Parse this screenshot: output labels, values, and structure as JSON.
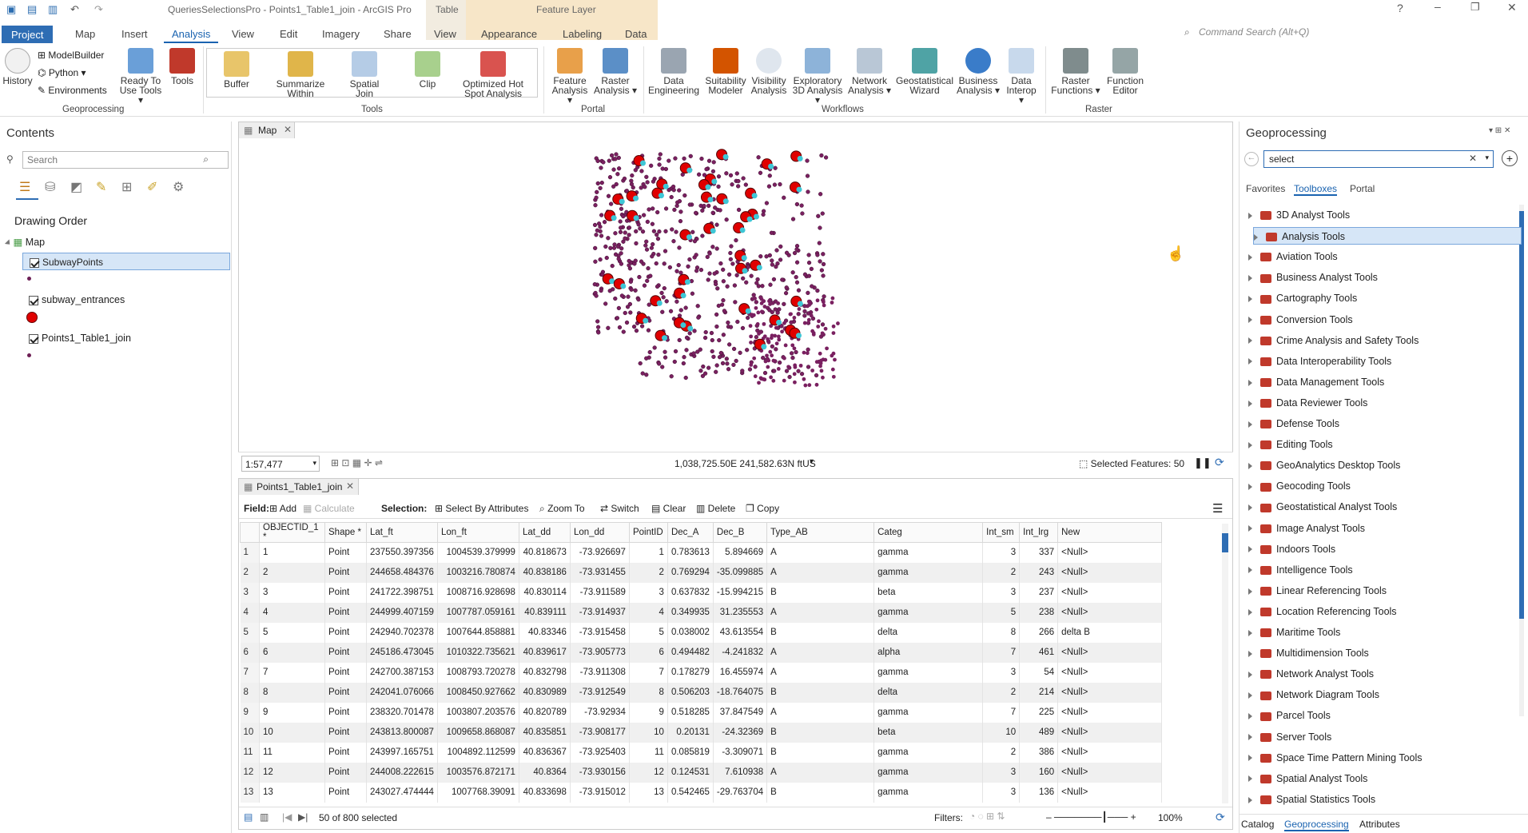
{
  "app_title": "QueriesSelectionsPro - Points1_Table1_join - ArcGIS Pro",
  "contextual": {
    "table": "Table",
    "feature_layer": "Feature Layer"
  },
  "tabs": [
    "Project",
    "Map",
    "Insert",
    "Analysis",
    "View",
    "Edit",
    "Imagery",
    "Share",
    "View",
    "Appearance",
    "Labeling",
    "Data"
  ],
  "command_search": "Command Search (Alt+Q)",
  "ribbon": {
    "history": "History",
    "modelbuilder": "ModelBuilder",
    "python": "Python",
    "environments": "Environments",
    "ready": "Ready To Use Tools",
    "tools": "Tools",
    "buffer": "Buffer",
    "summarize": "Summarize Within",
    "spatial_join": "Spatial Join",
    "clip": "Clip",
    "hotspot": "Optimized Hot Spot Analysis",
    "feature_analysis": "Feature Analysis",
    "raster_analysis": "Raster Analysis",
    "data_eng": "Data Engineering",
    "suitability": "Suitability Modeler",
    "visibility": "Visibility Analysis",
    "exploratory": "Exploratory 3D Analysis",
    "network": "Network Analysis",
    "geostat": "Geostatistical Wizard",
    "business": "Business Analysis",
    "interop": "Data Interop",
    "raster_functions": "Raster Functions",
    "function_editor": "Function Editor",
    "groups": {
      "geoprocessing": "Geoprocessing",
      "tools": "Tools",
      "portal": "Portal",
      "workflows": "Workflows",
      "raster": "Raster"
    }
  },
  "contents": {
    "title": "Contents",
    "search_placeholder": "Search",
    "drawing_order": "Drawing Order",
    "map": "Map",
    "layers": [
      "SubwayPoints",
      "subway_entrances",
      "Points1_Table1_join"
    ]
  },
  "map_tab": "Map",
  "map_footer": {
    "scale": "1:57,477",
    "coords": "1,038,725.50E 241,582.63N ftUS",
    "selected": "Selected Features: 50"
  },
  "table_tab": "Points1_Table1_join",
  "table_toolbar": {
    "field": "Field:",
    "add": "Add",
    "calculate": "Calculate",
    "selection": "Selection:",
    "select_attr": "Select By Attributes",
    "zoom": "Zoom To",
    "switch": "Switch",
    "clear": "Clear",
    "delete": "Delete",
    "copy": "Copy"
  },
  "table": {
    "columns": [
      "OBJECTID_1 *",
      "Shape *",
      "Lat_ft",
      "Lon_ft",
      "Lat_dd",
      "Lon_dd",
      "PointID",
      "Dec_A",
      "Dec_B",
      "Type_AB",
      "Categ",
      "Int_sm",
      "Int_lrg",
      "New"
    ],
    "rows": [
      [
        "1",
        "Point",
        "237550.397356",
        "1004539.379999",
        "40.818673",
        "-73.926697",
        "1",
        "0.783613",
        "5.894669",
        "A",
        "gamma",
        "3",
        "337",
        "<Null>"
      ],
      [
        "2",
        "Point",
        "244658.484376",
        "1003216.780874",
        "40.838186",
        "-73.931455",
        "2",
        "0.769294",
        "-35.099885",
        "A",
        "gamma",
        "2",
        "243",
        "<Null>"
      ],
      [
        "3",
        "Point",
        "241722.398751",
        "1008716.928698",
        "40.830114",
        "-73.911589",
        "3",
        "0.637832",
        "-15.994215",
        "B",
        "beta",
        "3",
        "237",
        "<Null>"
      ],
      [
        "4",
        "Point",
        "244999.407159",
        "1007787.059161",
        "40.839111",
        "-73.914937",
        "4",
        "0.349935",
        "31.235553",
        "A",
        "gamma",
        "5",
        "238",
        "<Null>"
      ],
      [
        "5",
        "Point",
        "242940.702378",
        "1007644.858881",
        "40.83346",
        "-73.915458",
        "5",
        "0.038002",
        "43.613554",
        "B",
        "delta",
        "8",
        "266",
        "delta B"
      ],
      [
        "6",
        "Point",
        "245186.473045",
        "1010322.735621",
        "40.839617",
        "-73.905773",
        "6",
        "0.494482",
        "-4.241832",
        "A",
        "alpha",
        "7",
        "461",
        "<Null>"
      ],
      [
        "7",
        "Point",
        "242700.387153",
        "1008793.720278",
        "40.832798",
        "-73.911308",
        "7",
        "0.178279",
        "16.455974",
        "A",
        "gamma",
        "3",
        "54",
        "<Null>"
      ],
      [
        "8",
        "Point",
        "242041.076066",
        "1008450.927662",
        "40.830989",
        "-73.912549",
        "8",
        "0.506203",
        "-18.764075",
        "B",
        "delta",
        "2",
        "214",
        "<Null>"
      ],
      [
        "9",
        "Point",
        "238320.701478",
        "1003807.203576",
        "40.820789",
        "-73.92934",
        "9",
        "0.518285",
        "37.847549",
        "A",
        "gamma",
        "7",
        "225",
        "<Null>"
      ],
      [
        "10",
        "Point",
        "243813.800087",
        "1009658.868087",
        "40.835851",
        "-73.908177",
        "10",
        "0.20131",
        "-24.32369",
        "B",
        "beta",
        "10",
        "489",
        "<Null>"
      ],
      [
        "11",
        "Point",
        "243997.165751",
        "1004892.112599",
        "40.836367",
        "-73.925403",
        "11",
        "0.085819",
        "-3.309071",
        "B",
        "gamma",
        "2",
        "386",
        "<Null>"
      ],
      [
        "12",
        "Point",
        "244008.222615",
        "1003576.872171",
        "40.8364",
        "-73.930156",
        "12",
        "0.124531",
        "7.610938",
        "A",
        "gamma",
        "3",
        "160",
        "<Null>"
      ],
      [
        "13",
        "Point",
        "243027.474444",
        "1007768.39091",
        "40.833698",
        "-73.915012",
        "13",
        "0.542465",
        "-29.763704",
        "B",
        "gamma",
        "3",
        "136",
        "<Null>"
      ]
    ]
  },
  "table_footer": {
    "selected": "50 of 800 selected",
    "filters": "Filters:",
    "zoom": "100%"
  },
  "geoprocessing": {
    "title": "Geoprocessing",
    "search_value": "select",
    "tabs": [
      "Favorites",
      "Toolboxes",
      "Portal"
    ],
    "toolboxes": [
      "3D Analyst Tools",
      "Analysis Tools",
      "Aviation Tools",
      "Business Analyst Tools",
      "Cartography Tools",
      "Conversion Tools",
      "Crime Analysis and Safety Tools",
      "Data Interoperability Tools",
      "Data Management Tools",
      "Data Reviewer Tools",
      "Defense Tools",
      "Editing Tools",
      "GeoAnalytics Desktop Tools",
      "Geocoding Tools",
      "Geostatistical Analyst Tools",
      "Image Analyst Tools",
      "Indoors Tools",
      "Intelligence Tools",
      "Linear Referencing Tools",
      "Location Referencing Tools",
      "Maritime Tools",
      "Multidimension Tools",
      "Network Analyst Tools",
      "Network Diagram Tools",
      "Parcel Tools",
      "Server Tools",
      "Space Time Pattern Mining Tools",
      "Spatial Analyst Tools",
      "Spatial Statistics Tools"
    ],
    "bottom_tabs": [
      "Catalog",
      "Geoprocessing",
      "Attributes"
    ]
  }
}
